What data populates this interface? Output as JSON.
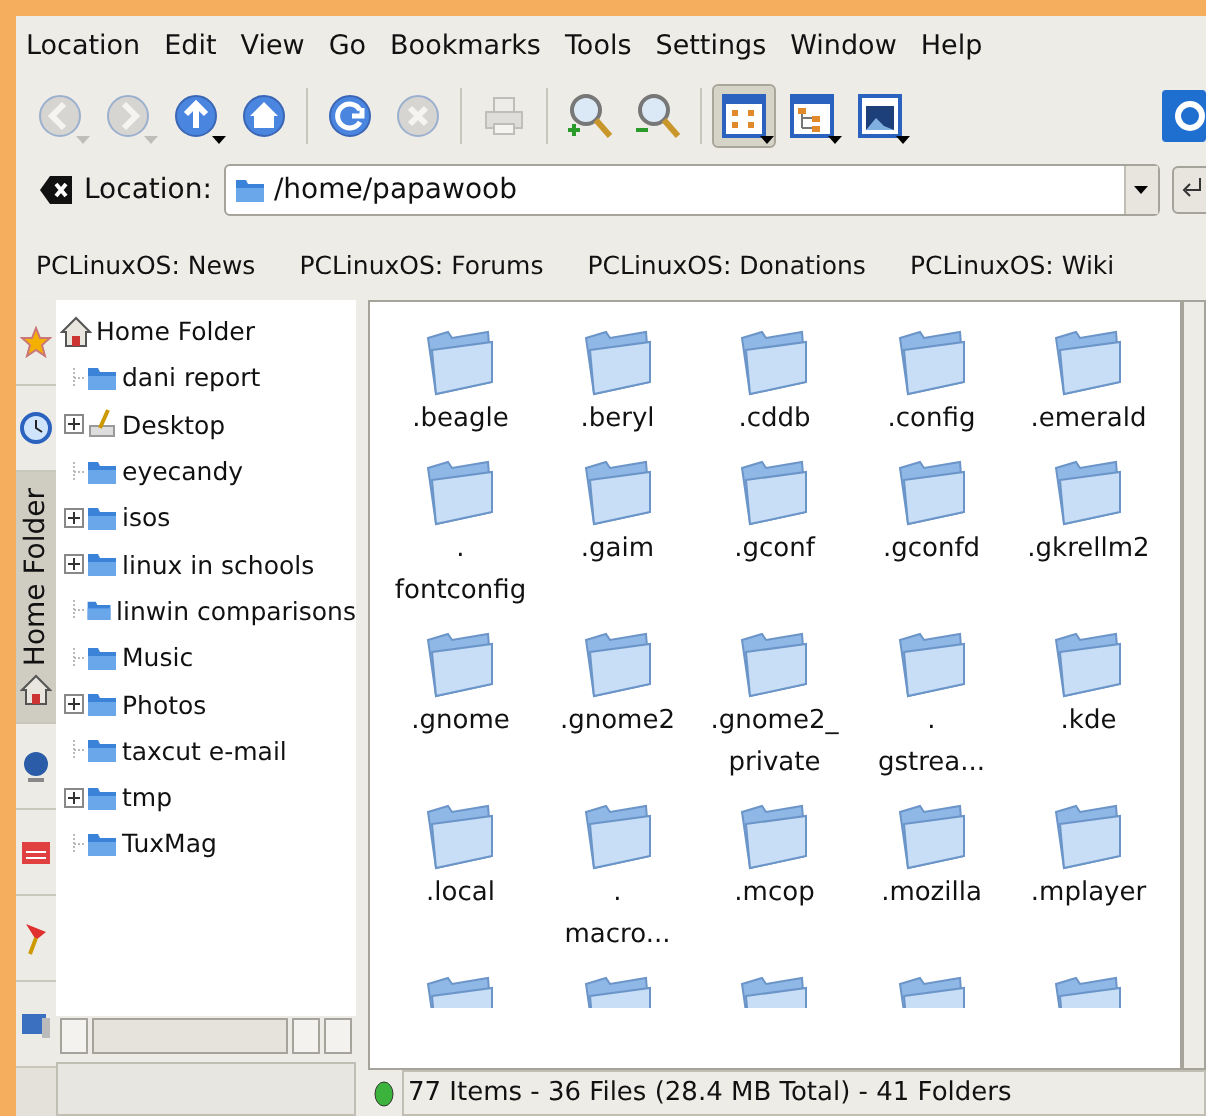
{
  "menu": [
    "Location",
    "Edit",
    "View",
    "Go",
    "Bookmarks",
    "Tools",
    "Settings",
    "Window",
    "Help"
  ],
  "toolbar": [
    {
      "kind": "back",
      "disabled": true,
      "dropdown": true,
      "selected": false
    },
    {
      "kind": "forward",
      "disabled": true,
      "dropdown": true,
      "selected": false
    },
    {
      "kind": "up",
      "disabled": false,
      "dropdown": true,
      "selected": false
    },
    {
      "kind": "home",
      "disabled": false,
      "dropdown": false,
      "selected": false
    },
    {
      "kind": "sep"
    },
    {
      "kind": "reload",
      "disabled": false,
      "dropdown": false,
      "selected": false
    },
    {
      "kind": "stop",
      "disabled": true,
      "dropdown": false,
      "selected": false
    },
    {
      "kind": "sep"
    },
    {
      "kind": "print",
      "disabled": true,
      "dropdown": false,
      "selected": false
    },
    {
      "kind": "sep"
    },
    {
      "kind": "zoomin",
      "disabled": false,
      "dropdown": false,
      "selected": false
    },
    {
      "kind": "zoomout",
      "disabled": false,
      "dropdown": false,
      "selected": false
    },
    {
      "kind": "sep"
    },
    {
      "kind": "iconview",
      "disabled": false,
      "dropdown": true,
      "selected": true
    },
    {
      "kind": "treeview",
      "disabled": false,
      "dropdown": true,
      "selected": false
    },
    {
      "kind": "imageview",
      "disabled": false,
      "dropdown": true,
      "selected": false
    }
  ],
  "location": {
    "label": "Location:",
    "value": "/home/papawoob"
  },
  "bookmarks": [
    "PCLinuxOS: News",
    "PCLinuxOS: Forums",
    "PCLinuxOS: Donations",
    "PCLinuxOS: Wiki"
  ],
  "sidebar_tabs": [
    {
      "kind": "bookmarks",
      "selected": false
    },
    {
      "kind": "history",
      "selected": false
    },
    {
      "kind": "home",
      "label": "Home Folder",
      "selected": true
    },
    {
      "kind": "network",
      "selected": false
    },
    {
      "kind": "services",
      "selected": false
    },
    {
      "kind": "pin",
      "selected": false
    },
    {
      "kind": "media",
      "selected": false
    }
  ],
  "tree": {
    "label": "Home Folder",
    "kind": "home",
    "children": [
      {
        "label": "dani report",
        "kind": "folder",
        "expandable": false
      },
      {
        "label": "Desktop",
        "kind": "desktop",
        "expandable": true
      },
      {
        "label": "eyecandy",
        "kind": "folder",
        "expandable": false
      },
      {
        "label": "isos",
        "kind": "folder",
        "expandable": true
      },
      {
        "label": "linux in schools",
        "kind": "folder",
        "expandable": true
      },
      {
        "label": "linwin comparisons",
        "kind": "folder",
        "expandable": false
      },
      {
        "label": "Music",
        "kind": "folder",
        "expandable": false
      },
      {
        "label": "Photos",
        "kind": "folder",
        "expandable": true
      },
      {
        "label": "taxcut e-mail",
        "kind": "folder",
        "expandable": false
      },
      {
        "label": "tmp",
        "kind": "folder",
        "expandable": true
      },
      {
        "label": "TuxMag",
        "kind": "folder",
        "expandable": false
      }
    ]
  },
  "files": [
    {
      "lines": [
        ".beagle"
      ]
    },
    {
      "lines": [
        ".beryl"
      ]
    },
    {
      "lines": [
        ".cddb"
      ]
    },
    {
      "lines": [
        ".config"
      ]
    },
    {
      "lines": [
        ".emerald"
      ]
    },
    {
      "lines": [
        ".",
        "fontconfig"
      ]
    },
    {
      "lines": [
        ".gaim"
      ]
    },
    {
      "lines": [
        ".gconf"
      ]
    },
    {
      "lines": [
        ".gconfd"
      ]
    },
    {
      "lines": [
        ".gkrellm2"
      ]
    },
    {
      "lines": [
        ".gnome"
      ]
    },
    {
      "lines": [
        ".gnome2"
      ]
    },
    {
      "lines": [
        ".gnome2_",
        "private"
      ]
    },
    {
      "lines": [
        ".",
        "gstrea..."
      ]
    },
    {
      "lines": [
        ".kde"
      ]
    },
    {
      "lines": [
        ".local"
      ]
    },
    {
      "lines": [
        ".",
        "macro..."
      ]
    },
    {
      "lines": [
        ".mcop"
      ]
    },
    {
      "lines": [
        ".mozilla"
      ]
    },
    {
      "lines": [
        ".mplayer"
      ]
    },
    {
      "partial": true
    },
    {
      "partial": true
    },
    {
      "partial": true
    },
    {
      "partial": true
    },
    {
      "partial": true
    }
  ],
  "status": {
    "text": "77 Items - 36 Files (28.4 MB Total) - 41 Folders",
    "online": true
  }
}
